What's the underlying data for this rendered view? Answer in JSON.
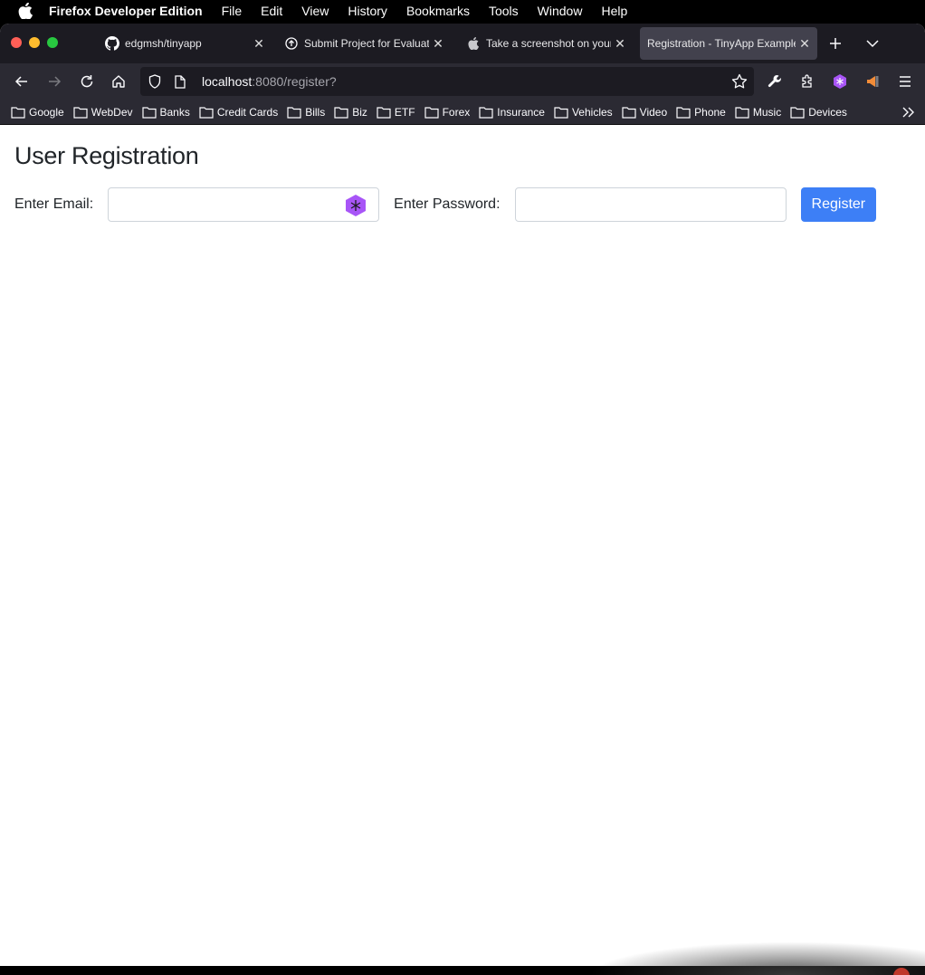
{
  "menubar": {
    "app_name": "Firefox Developer Edition",
    "items": [
      "File",
      "Edit",
      "View",
      "History",
      "Bookmarks",
      "Tools",
      "Window",
      "Help"
    ]
  },
  "tabs": [
    {
      "title": "edgmsh/tinyapp",
      "icon": "github-icon",
      "active": false
    },
    {
      "title": "Submit Project for Evaluation",
      "icon": "submit-icon",
      "active": false
    },
    {
      "title": "Take a screenshot on your Mac",
      "icon": "apple-icon",
      "active": false
    },
    {
      "title": "Registration - TinyApp Example",
      "icon": null,
      "active": true
    }
  ],
  "urlbar": {
    "host": "localhost",
    "path": ":8080/register?"
  },
  "bookmarks": [
    "Google",
    "WebDev",
    "Banks",
    "Credit Cards",
    "Bills",
    "Biz",
    "ETF",
    "Forex",
    "Insurance",
    "Vehicles",
    "Video",
    "Phone",
    "Music",
    "Devices"
  ],
  "page": {
    "title": "User Registration",
    "email_label": "Enter Email:",
    "email_value": "",
    "password_label": "Enter Password:",
    "password_value": "",
    "register_button": "Register"
  },
  "colors": {
    "tab_bar": "#1c1b22",
    "toolbar": "#2b2a33",
    "active_tab": "#42414d",
    "primary_button": "#3d7ff6",
    "extension_purple": "#a855f7"
  }
}
